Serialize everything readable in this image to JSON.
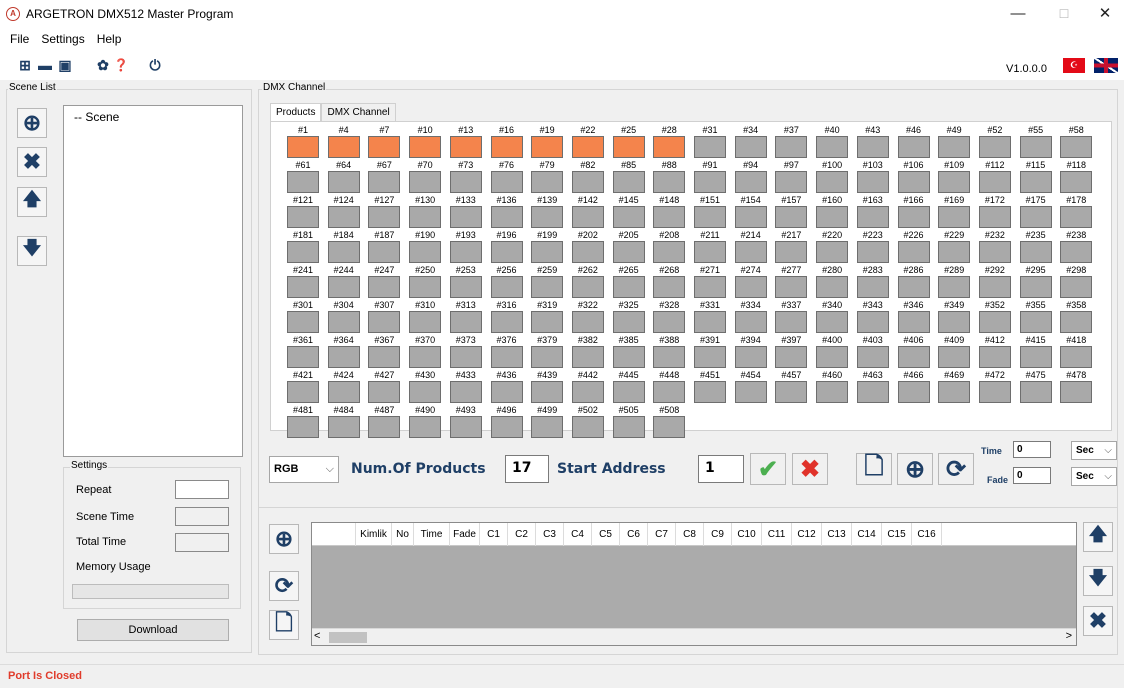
{
  "window": {
    "title": "ARGETRON DMX512 Master Program",
    "minimize": "—",
    "maximize": "☐",
    "close": "✕"
  },
  "menu": [
    "File",
    "Settings",
    "Help"
  ],
  "toolbar": {
    "version": "V1.0.0.0",
    "flag_tr": "☪",
    "new": "⊞",
    "open": "▬",
    "save": "▣",
    "settings": "✿",
    "help": "❓",
    "power": "⏻"
  },
  "scene_list": {
    "label": "Scene List",
    "tree_root": "-- Scene",
    "add": "⊕",
    "delete": "✖",
    "up": "🡅",
    "down": "🡇"
  },
  "settings": {
    "label": "Settings",
    "repeat": "Repeat",
    "scene_time": "Scene Time",
    "total_time": "Total Time",
    "memory_usage": "Memory Usage",
    "download": "Download"
  },
  "dmx": {
    "label": "DMX Channel",
    "tabs": [
      "Products",
      "DMX Channel"
    ],
    "channels": [
      "#1",
      "#4",
      "#7",
      "#10",
      "#13",
      "#16",
      "#19",
      "#22",
      "#25",
      "#28",
      "#31",
      "#34",
      "#37",
      "#40",
      "#43",
      "#46",
      "#49",
      "#52",
      "#55",
      "#58",
      "#61",
      "#64",
      "#67",
      "#70",
      "#73",
      "#76",
      "#79",
      "#82",
      "#85",
      "#88",
      "#91",
      "#94",
      "#97",
      "#100",
      "#103",
      "#106",
      "#109",
      "#112",
      "#115",
      "#118",
      "#121",
      "#124",
      "#127",
      "#130",
      "#133",
      "#136",
      "#139",
      "#142",
      "#145",
      "#148",
      "#151",
      "#154",
      "#157",
      "#160",
      "#163",
      "#166",
      "#169",
      "#172",
      "#175",
      "#178",
      "#181",
      "#184",
      "#187",
      "#190",
      "#193",
      "#196",
      "#199",
      "#202",
      "#205",
      "#208",
      "#211",
      "#214",
      "#217",
      "#220",
      "#223",
      "#226",
      "#229",
      "#232",
      "#235",
      "#238",
      "#241",
      "#244",
      "#247",
      "#250",
      "#253",
      "#256",
      "#259",
      "#262",
      "#265",
      "#268",
      "#271",
      "#274",
      "#277",
      "#280",
      "#283",
      "#286",
      "#289",
      "#292",
      "#295",
      "#298",
      "#301",
      "#304",
      "#307",
      "#310",
      "#313",
      "#316",
      "#319",
      "#322",
      "#325",
      "#328",
      "#331",
      "#334",
      "#337",
      "#340",
      "#343",
      "#346",
      "#349",
      "#352",
      "#355",
      "#358",
      "#361",
      "#364",
      "#367",
      "#370",
      "#373",
      "#376",
      "#379",
      "#382",
      "#385",
      "#388",
      "#391",
      "#394",
      "#397",
      "#400",
      "#403",
      "#406",
      "#409",
      "#412",
      "#415",
      "#418",
      "#421",
      "#424",
      "#427",
      "#430",
      "#433",
      "#436",
      "#439",
      "#442",
      "#445",
      "#448",
      "#451",
      "#454",
      "#457",
      "#460",
      "#463",
      "#466",
      "#469",
      "#472",
      "#475",
      "#478",
      "#481",
      "#484",
      "#487",
      "#490",
      "#493",
      "#496",
      "#499",
      "#502",
      "#505",
      "#508"
    ],
    "active_count": 10,
    "active_color": "#f4844c",
    "inactive_color": "#a9a9a9"
  },
  "controls": {
    "mode": "RGB",
    "num_products_label": "Num.Of Products",
    "num_products": "17",
    "start_address_label": "Start Address",
    "start_address": "1",
    "ok": "✔",
    "cancel": "✖",
    "new": "🗋",
    "add": "⊕",
    "refresh": "⟳",
    "time_label": "Time",
    "time_value": "0",
    "time_unit": "Sec",
    "fade_label": "Fade",
    "fade_value": "0",
    "fade_unit": "Sec"
  },
  "sequence": {
    "columns": [
      "",
      "Kimlik",
      "No",
      "Time",
      "Fade",
      "C1",
      "C2",
      "C3",
      "C4",
      "C5",
      "C6",
      "C7",
      "C8",
      "C9",
      "C10",
      "C11",
      "C12",
      "C13",
      "C14",
      "C15",
      "C16"
    ],
    "add": "⊕",
    "refresh": "⟳",
    "new": "🗋",
    "up": "🡅",
    "down": "🡇",
    "delete": "✖",
    "scroll_left": "<",
    "scroll_right": ">"
  },
  "status": {
    "text": "Port Is Closed"
  }
}
